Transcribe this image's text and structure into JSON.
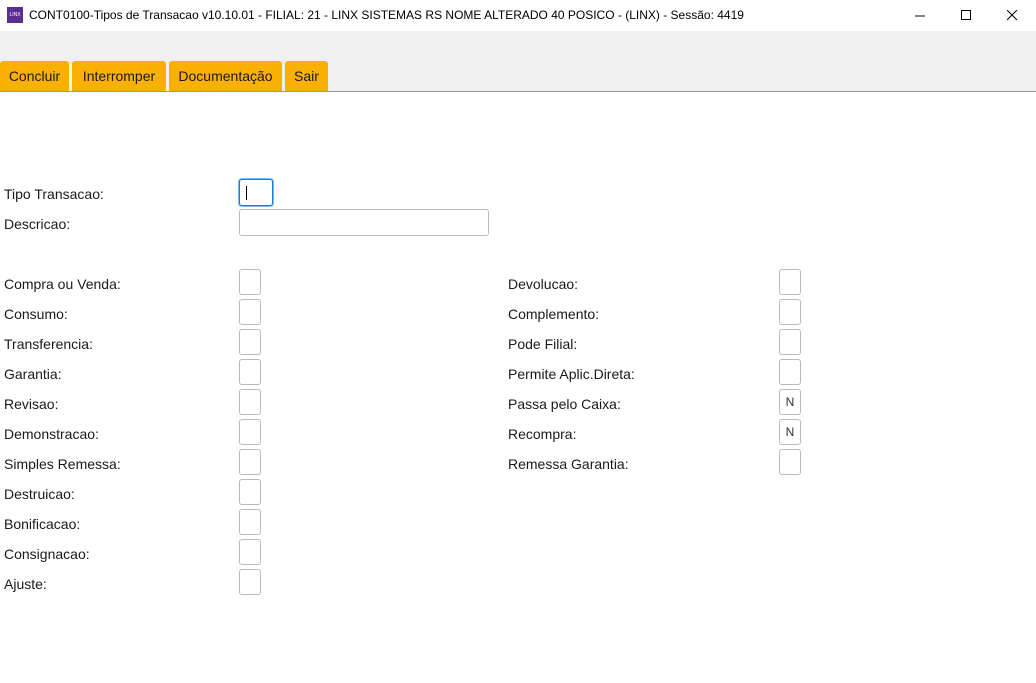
{
  "window": {
    "title": "CONT0100-Tipos de Transacao v10.10.01   - FILIAL: 21 - LINX SISTEMAS RS NOME ALTERADO 40 POSICO - (LINX) - Sessão: 4419",
    "icon_text": "LINX"
  },
  "toolbar": {
    "concluir": "Concluir",
    "interromper": "Interromper",
    "documentacao": "Documentação",
    "sair": "Sair"
  },
  "form": {
    "tipo_transacao": {
      "label": "Tipo Transacao:",
      "value": ""
    },
    "descricao": {
      "label": "Descricao:",
      "value": ""
    },
    "left_fields": [
      {
        "label": "Compra ou Venda:",
        "value": ""
      },
      {
        "label": "Consumo:",
        "value": ""
      },
      {
        "label": "Transferencia:",
        "value": ""
      },
      {
        "label": "Garantia:",
        "value": ""
      },
      {
        "label": "Revisao:",
        "value": ""
      },
      {
        "label": "Demonstracao:",
        "value": ""
      },
      {
        "label": "Simples Remessa:",
        "value": ""
      },
      {
        "label": "Destruicao:",
        "value": ""
      },
      {
        "label": "Bonificacao:",
        "value": ""
      },
      {
        "label": "Consignacao:",
        "value": ""
      },
      {
        "label": "Ajuste:",
        "value": ""
      }
    ],
    "right_fields": [
      {
        "label": "Devolucao:",
        "value": ""
      },
      {
        "label": "Complemento:",
        "value": ""
      },
      {
        "label": "Pode Filial:",
        "value": ""
      },
      {
        "label": "Permite Aplic.Direta:",
        "value": ""
      },
      {
        "label": "Passa pelo Caixa:",
        "value": "N"
      },
      {
        "label": "Recompra:",
        "value": "N"
      },
      {
        "label": "Remessa Garantia:",
        "value": ""
      }
    ]
  }
}
